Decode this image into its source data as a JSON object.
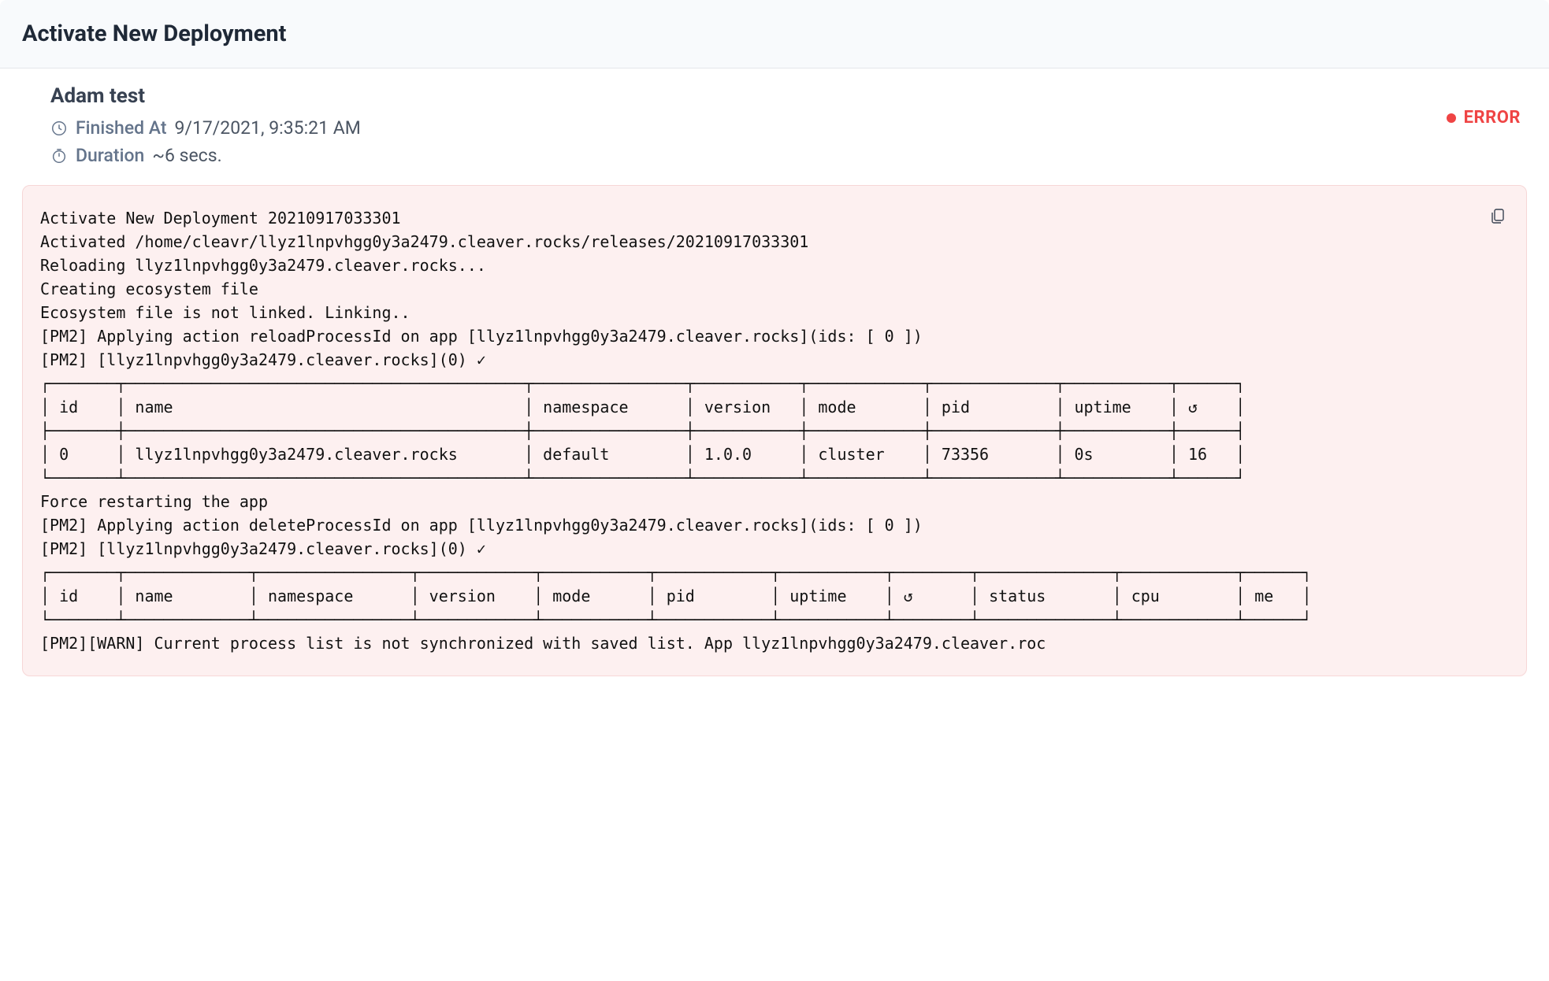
{
  "header": {
    "title": "Activate New Deployment"
  },
  "meta": {
    "title": "Adam test",
    "finished_label": "Finished At",
    "finished_value": "9/17/2021, 9:35:21 AM",
    "duration_label": "Duration",
    "duration_value": "~6 secs."
  },
  "status": {
    "label": "ERROR"
  },
  "log": {
    "prelude": "Activate New Deployment 20210917033301\nActivated /home/cleavr/llyz1lnpvhgg0y3a2479.cleaver.rocks/releases/20210917033301\nReloading llyz1lnpvhgg0y3a2479.cleaver.rocks...\nCreating ecosystem file\nEcosystem file is not linked. Linking..\n[PM2] Applying action reloadProcessId on app [llyz1lnpvhgg0y3a2479.cleaver.rocks](ids: [ 0 ])\n[PM2] [llyz1lnpvhgg0y3a2479.cleaver.rocks](0) ✓",
    "table1": {
      "columns": [
        "id",
        "name",
        "namespace",
        "version",
        "mode",
        "pid",
        "uptime",
        "↺"
      ],
      "widths": [
        5,
        40,
        14,
        9,
        10,
        11,
        9,
        4
      ],
      "rows": [
        [
          "0",
          "llyz1lnpvhgg0y3a2479.cleaver.rocks",
          "default",
          "1.0.0",
          "cluster",
          "73356",
          "0s",
          "16"
        ]
      ]
    },
    "mid": "Force restarting the app\n[PM2] Applying action deleteProcessId on app [llyz1lnpvhgg0y3a2479.cleaver.rocks](ids: [ 0 ])\n[PM2] [llyz1lnpvhgg0y3a2479.cleaver.rocks](0) ✓",
    "table2": {
      "columns": [
        "id",
        "name",
        "namespace",
        "version",
        "mode",
        "pid",
        "uptime",
        "↺",
        "status",
        "cpu",
        "me"
      ],
      "widths": [
        5,
        11,
        14,
        10,
        9,
        10,
        9,
        6,
        12,
        10,
        4
      ],
      "rows": []
    },
    "trailer": "[PM2][WARN] Current process list is not synchronized with saved list. App llyz1lnpvhgg0y3a2479.cleaver.roc"
  }
}
